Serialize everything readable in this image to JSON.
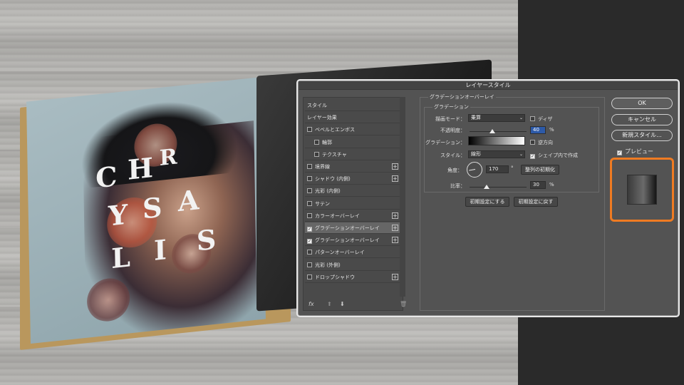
{
  "dialog": {
    "title": "レイヤースタイル"
  },
  "styles_list": {
    "items": [
      {
        "label": "スタイル",
        "checkbox": false,
        "checked": false,
        "plus": false,
        "selected": false
      },
      {
        "label": "レイヤー効果",
        "checkbox": false,
        "checked": false,
        "plus": false,
        "selected": false
      },
      {
        "label": "ベベルとエンボス",
        "checkbox": true,
        "checked": false,
        "plus": false,
        "selected": false
      },
      {
        "label": "輪郭",
        "checkbox": true,
        "checked": false,
        "plus": false,
        "selected": false,
        "indent": true
      },
      {
        "label": "テクスチャ",
        "checkbox": true,
        "checked": false,
        "plus": false,
        "selected": false,
        "indent": true
      },
      {
        "label": "境界線",
        "checkbox": true,
        "checked": false,
        "plus": true,
        "selected": false
      },
      {
        "label": "シャドウ (内側)",
        "checkbox": true,
        "checked": false,
        "plus": true,
        "selected": false
      },
      {
        "label": "光彩 (内側)",
        "checkbox": true,
        "checked": false,
        "plus": false,
        "selected": false
      },
      {
        "label": "サテン",
        "checkbox": true,
        "checked": false,
        "plus": false,
        "selected": false
      },
      {
        "label": "カラーオーバーレイ",
        "checkbox": true,
        "checked": false,
        "plus": true,
        "selected": false
      },
      {
        "label": "グラデーションオーバーレイ",
        "checkbox": true,
        "checked": true,
        "plus": true,
        "selected": true
      },
      {
        "label": "グラデーションオーバーレイ",
        "checkbox": true,
        "checked": true,
        "plus": true,
        "selected": false
      },
      {
        "label": "パターンオーバーレイ",
        "checkbox": true,
        "checked": false,
        "plus": false,
        "selected": false
      },
      {
        "label": "光彩 (外側)",
        "checkbox": true,
        "checked": false,
        "plus": false,
        "selected": false
      },
      {
        "label": "ドロップシャドウ",
        "checkbox": true,
        "checked": false,
        "plus": true,
        "selected": false
      }
    ],
    "fx_label": "fx"
  },
  "panel": {
    "section_title": "グラデーションオーバーレイ",
    "group_title": "グラデーション",
    "blend_mode_label": "描画モード：",
    "blend_mode_value": "乗算",
    "dither_label": "ディザ",
    "opacity_label": "不透明度：",
    "opacity_value": "40",
    "opacity_unit": "%",
    "opacity_level": 0.4,
    "gradient_label": "グラデーション：",
    "reverse_label": "逆方向",
    "style_label": "スタイル：",
    "style_value": "線形",
    "align_label": "シェイプ内で作成",
    "align_checked": true,
    "angle_label": "角度：",
    "angle_value": "170",
    "angle_unit": "°",
    "reset_alignment_label": "整列の初期化",
    "scale_label": "比率：",
    "scale_value": "30",
    "scale_unit": "%",
    "scale_level": 0.3,
    "make_default_label": "初期設定にする",
    "reset_default_label": "初期設定に戻す"
  },
  "right_buttons": {
    "ok": "OK",
    "cancel": "キャンセル",
    "new_style": "新規スタイル...",
    "preview_label": "プレビュー",
    "preview_checked": true
  },
  "colors": {
    "highlight": "#ef7b22",
    "dialog_bg": "#535353"
  },
  "background_book": {
    "letters": [
      "C",
      "H",
      "R",
      "Y",
      "S",
      "A",
      "L",
      "I",
      "S"
    ]
  }
}
